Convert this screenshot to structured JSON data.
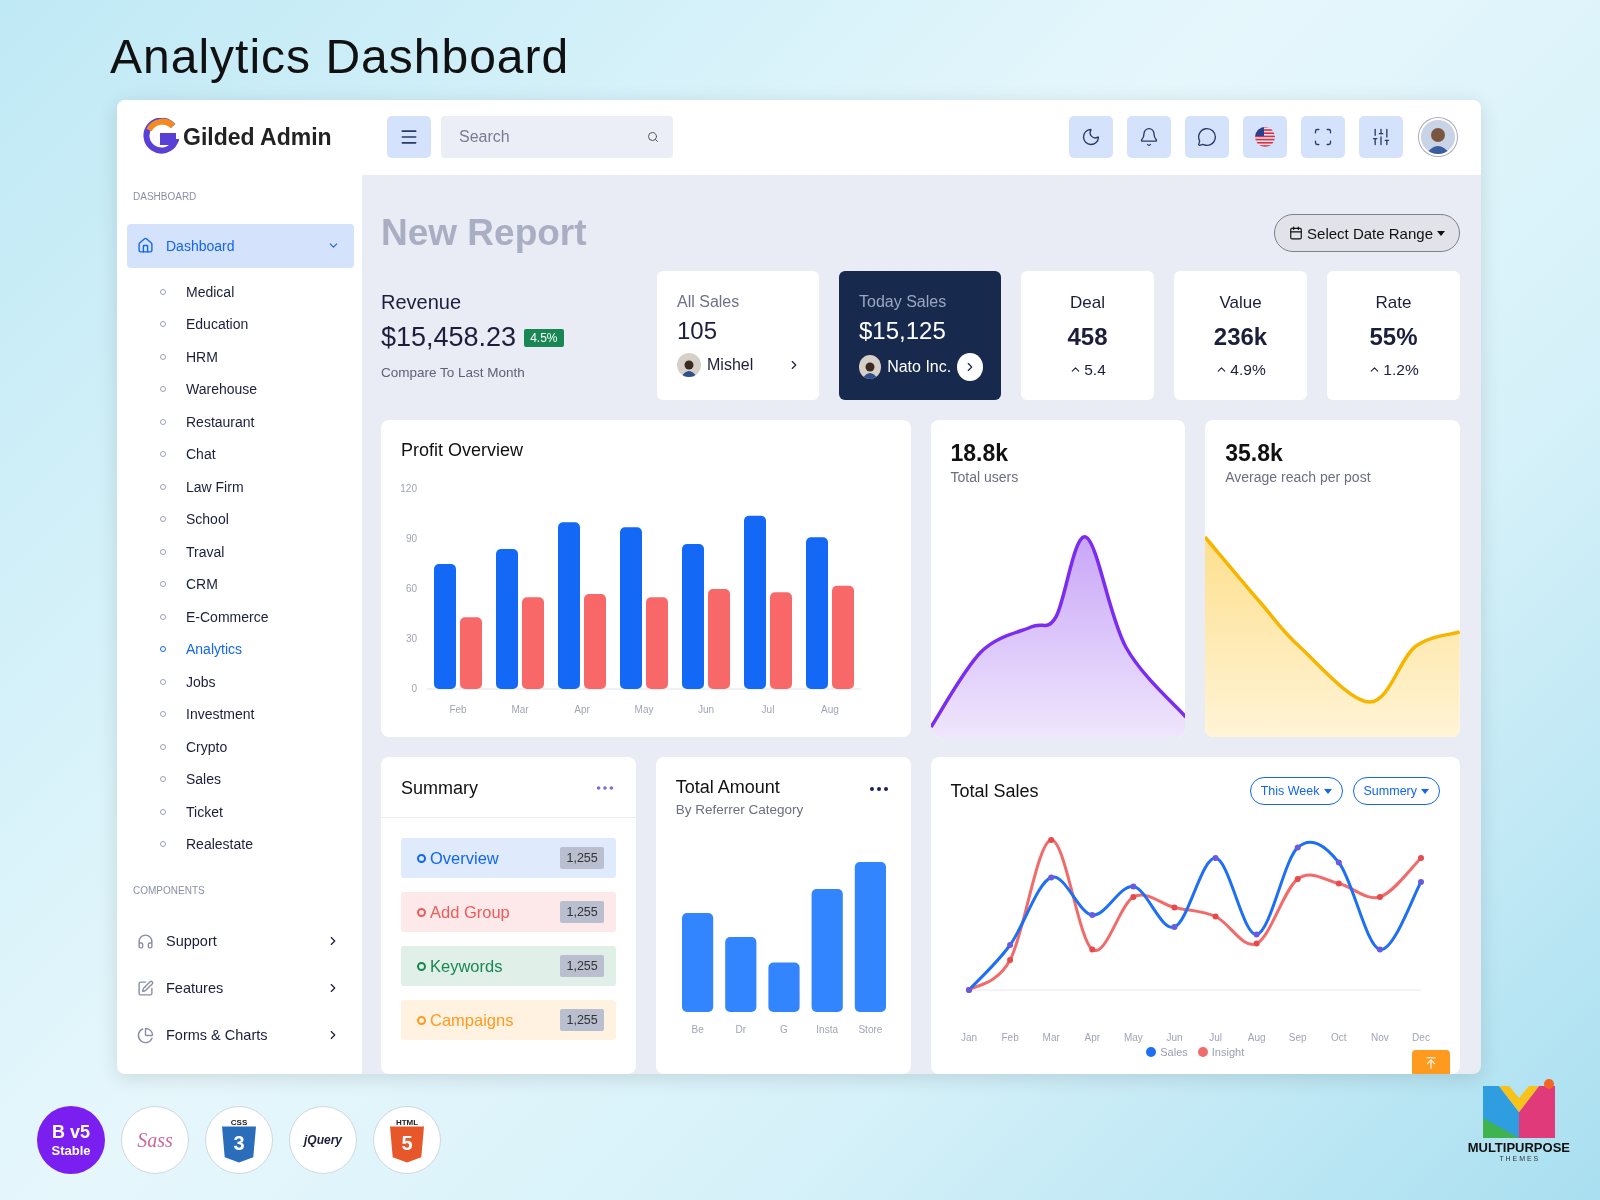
{
  "page_title": "Analytics Dashboard",
  "header": {
    "brand": "Gilded Admin",
    "search": {
      "placeholder": "Search"
    }
  },
  "sidebar": {
    "sections": [
      {
        "label": "DASHBOARD",
        "items": [
          {
            "label": "Dashboard",
            "selected": true,
            "expanded": true,
            "children": [
              {
                "label": "Medical",
                "selected": false
              },
              {
                "label": "Education",
                "selected": false
              },
              {
                "label": "HRM",
                "selected": false
              },
              {
                "label": "Warehouse",
                "selected": false
              },
              {
                "label": "Restaurant",
                "selected": false
              },
              {
                "label": "Chat",
                "selected": false
              },
              {
                "label": "Law Firm",
                "selected": false
              },
              {
                "label": "School",
                "selected": false
              },
              {
                "label": "Traval",
                "selected": false
              },
              {
                "label": "CRM",
                "selected": false
              },
              {
                "label": "E-Commerce",
                "selected": false
              },
              {
                "label": "Analytics",
                "selected": true
              },
              {
                "label": "Jobs",
                "selected": false
              },
              {
                "label": "Investment",
                "selected": false
              },
              {
                "label": "Crypto",
                "selected": false
              },
              {
                "label": "Sales",
                "selected": false
              },
              {
                "label": "Ticket",
                "selected": false
              },
              {
                "label": "Realestate",
                "selected": false
              }
            ]
          }
        ]
      },
      {
        "label": "COMPONENTS",
        "items": [
          {
            "label": "Support",
            "selected": false,
            "expanded": false
          },
          {
            "label": "Features",
            "selected": false,
            "expanded": false
          },
          {
            "label": "Forms & Charts",
            "selected": false,
            "expanded": false
          }
        ]
      }
    ]
  },
  "report": {
    "title": "New Report",
    "date_range_button": "Select Date Range"
  },
  "revenue": {
    "title": "Revenue",
    "amount": "$15,458.23",
    "change": "4.5%",
    "note": "Compare To Last Month"
  },
  "sales_cards": [
    {
      "title": "All Sales",
      "value": "105",
      "party": "Mishel",
      "selected": false
    },
    {
      "title": "Today Sales",
      "value": "$15,125",
      "party": "Nato Inc.",
      "selected": true
    }
  ],
  "metrics": [
    {
      "title": "Deal",
      "value": "458",
      "change": "5.4"
    },
    {
      "title": "Value",
      "value": "236k",
      "change": "4.9%"
    },
    {
      "title": "Rate",
      "value": "55%",
      "change": "1.2%"
    }
  ],
  "profit_overview": {
    "title": "Profit Overview",
    "chart_data": {
      "type": "bar",
      "categories": [
        "Feb",
        "Mar",
        "Apr",
        "May",
        "Jun",
        "Jul",
        "Aug"
      ],
      "ylim": [
        0,
        120
      ],
      "yticks": [
        0,
        30,
        60,
        90,
        120
      ],
      "series": [
        {
          "color": "#1368f5",
          "values": [
            75,
            84,
            100,
            97,
            87,
            104,
            91
          ]
        },
        {
          "color": "#f86868",
          "values": [
            43,
            55,
            57,
            55,
            60,
            58,
            62
          ]
        }
      ]
    }
  },
  "spark_cards": [
    {
      "kind": "users",
      "value": "18.8k",
      "label": "Total users"
    },
    {
      "kind": "reach",
      "value": "35.8k",
      "label": "Average reach per post"
    }
  ],
  "summary": {
    "title": "Summary",
    "items": [
      {
        "label": "Overview",
        "count": "1,255",
        "color": "#1266f1"
      },
      {
        "label": "Add Group",
        "count": "1,255",
        "color": "#ef5b5b"
      },
      {
        "label": "Keywords",
        "count": "1,255",
        "color": "#198754"
      },
      {
        "label": "Campaigns",
        "count": "1,255",
        "color": "#ff9a1f"
      }
    ]
  },
  "total_amount": {
    "title": "Total Amount",
    "subtitle": "By Referrer Category",
    "x_labels": [
      "Be",
      "Dr",
      "G",
      "Insta",
      "Store"
    ]
  },
  "total_sales": {
    "title": "Total Sales",
    "filters": [
      "This Week",
      "Summery"
    ],
    "x_labels": [
      "Jan",
      "Feb",
      "Mar",
      "Apr",
      "May",
      "Jun",
      "Jul",
      "Aug",
      "Sep",
      "Oct",
      "Nov",
      "Dec"
    ],
    "legend": [
      {
        "label": "Sales",
        "color": "#1e6ff5"
      },
      {
        "label": "Insight",
        "color": "#f26b6b"
      }
    ]
  },
  "tech_badges": [
    {
      "kind": "bootstrap",
      "mark": "B",
      "version": "v5",
      "caption": "Stable"
    },
    {
      "kind": "sass",
      "mark": "Sass"
    },
    {
      "kind": "css",
      "caption": "CSS",
      "mark": "3"
    },
    {
      "kind": "jquery",
      "mark": "jQuery"
    },
    {
      "kind": "html",
      "caption": "HTML",
      "mark": "5"
    }
  ],
  "publisher": {
    "name": "MULTIPURPOSE",
    "sub": "T H E M E S"
  }
}
